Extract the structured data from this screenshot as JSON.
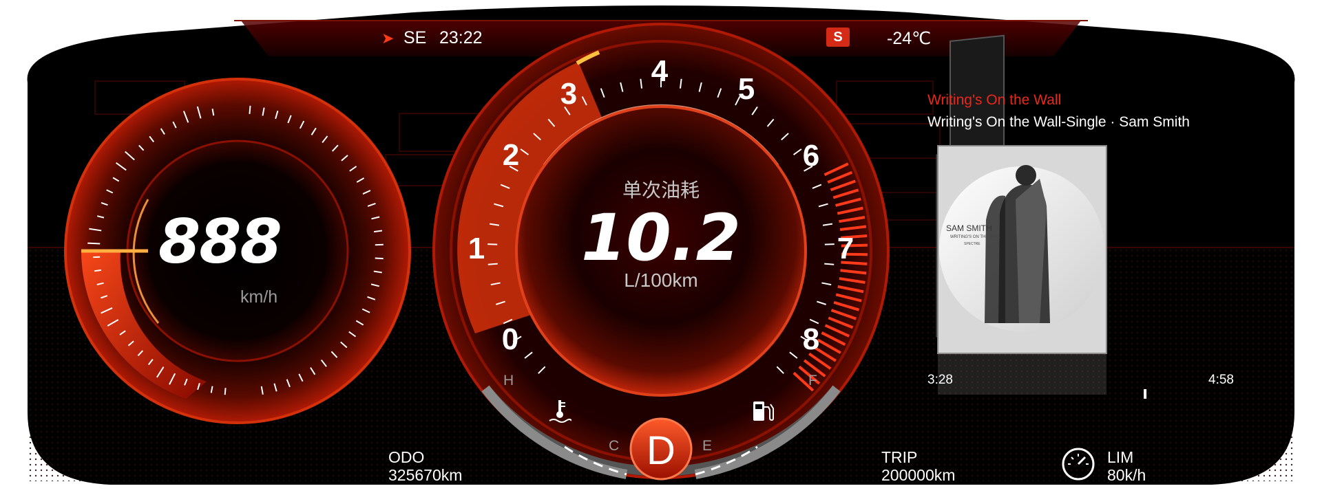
{
  "top_bar": {
    "direction": "SE",
    "time": "23:22",
    "mode_badge": "S",
    "temperature": "-24℃"
  },
  "speed": {
    "value": "888",
    "unit": "km/h"
  },
  "center_dial": {
    "title": "单次油耗",
    "value": "10.2",
    "unit": "L/100km",
    "scale_labels": [
      "0",
      "1",
      "2",
      "3",
      "4",
      "5",
      "6",
      "7",
      "8"
    ],
    "temp_hot_label": "H",
    "temp_cold_label": "C",
    "fuel_full_label": "F",
    "fuel_empty_label": "E",
    "gear": "D"
  },
  "media": {
    "track_title": "Writing's On the Wall",
    "album_artist": "Writing's On the Wall-Single · Sam Smith",
    "cover_artist": "SAM SMITH",
    "cover_subtitle": "WRITING'S ON THE WALL",
    "cover_tag": "SPECTRE",
    "elapsed": "3:28",
    "total": "4:58",
    "progress": 0.698
  },
  "odo": {
    "label": "ODO",
    "value": "325670km"
  },
  "trip": {
    "label": "TRIP",
    "value": "200000km"
  },
  "limit": {
    "label": "LIM",
    "value": "80k/h"
  },
  "icons": {
    "direction_arrow": "direction-arrow-icon",
    "coolant": "coolant-temperature-icon",
    "fuel": "fuel-pump-icon",
    "speed_limit": "speedometer-icon"
  },
  "colors": {
    "accent_red": "#e8281a",
    "badge_red": "#d42a16",
    "orange": "#ff9a1a",
    "background": "#000000"
  }
}
